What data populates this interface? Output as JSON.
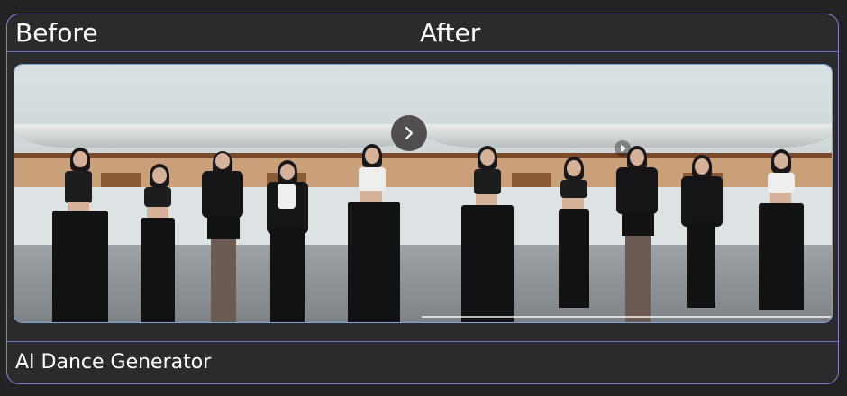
{
  "comparison": {
    "before_label": "Before",
    "after_label": "After"
  },
  "footer": {
    "title": "AI Dance Generator"
  },
  "icons": {
    "next": "chevron-right-icon",
    "play": "play-icon"
  },
  "colors": {
    "card_border": "#8a7fd6",
    "background": "#232224"
  }
}
